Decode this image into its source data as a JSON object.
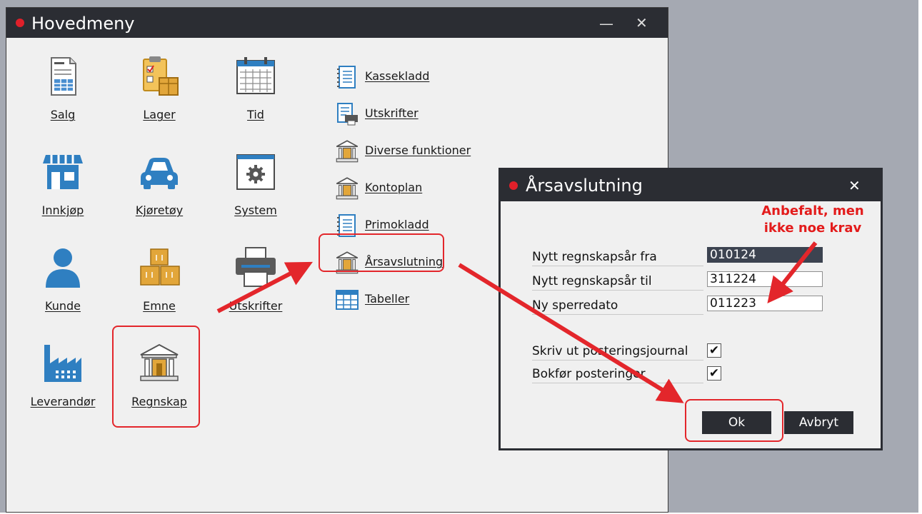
{
  "main_window": {
    "title": "Hovedmeny",
    "minimize": "—",
    "close": "✕",
    "tiles": [
      {
        "label": "Salg",
        "icon": "order-document-icon"
      },
      {
        "label": "Lager",
        "icon": "clipboard-boxes-icon"
      },
      {
        "label": "Tid",
        "icon": "calendar-icon"
      },
      {
        "label": "Innkjøp",
        "icon": "store-icon"
      },
      {
        "label": "Kjøretøy",
        "icon": "car-icon"
      },
      {
        "label": "System",
        "icon": "gear-window-icon"
      },
      {
        "label": "Kunde",
        "icon": "person-icon"
      },
      {
        "label": "Emne",
        "icon": "stacked-boxes-icon"
      },
      {
        "label": "Utskrifter",
        "icon": "printer-icon"
      },
      {
        "label": "Leverandør",
        "icon": "factory-icon"
      },
      {
        "label": "Regnskap",
        "icon": "bank-building-icon"
      }
    ],
    "menu": [
      {
        "label": "Kassekladd",
        "icon": "ledger-book-icon"
      },
      {
        "label": "Utskrifter",
        "icon": "print-document-icon"
      },
      {
        "label": "Diverse funktioner",
        "icon": "bank-building-icon"
      },
      {
        "label": "Kontoplan",
        "icon": "bank-building-icon"
      },
      {
        "label": "Primokladd",
        "icon": "ledger-book-icon"
      },
      {
        "label": "Årsavslutning",
        "icon": "bank-building-icon"
      },
      {
        "label": "Tabeller",
        "icon": "table-grid-icon"
      }
    ]
  },
  "dialog": {
    "title": "Årsavslutning",
    "close": "✕",
    "fields": [
      {
        "label": "Nytt regnskapsår fra",
        "value": "010124"
      },
      {
        "label": "Nytt regnskapsår til",
        "value": "311224"
      },
      {
        "label": "Ny sperredato",
        "value": "011223"
      }
    ],
    "checkboxes": [
      {
        "label": "Skriv ut posteringsjournal",
        "checked": "✔"
      },
      {
        "label": "Bokfør posteringer",
        "checked": "✔"
      }
    ],
    "ok_label": "Ok",
    "cancel_label": "Avbryt"
  },
  "annotation": {
    "line1": "Anbefalt, men",
    "line2": "ikke noe krav"
  },
  "colors": {
    "titlebar": "#2b2d33",
    "accent_red": "#e3262b",
    "tile_blue": "#2f7fc1",
    "tile_gold": "#e2a63a"
  }
}
